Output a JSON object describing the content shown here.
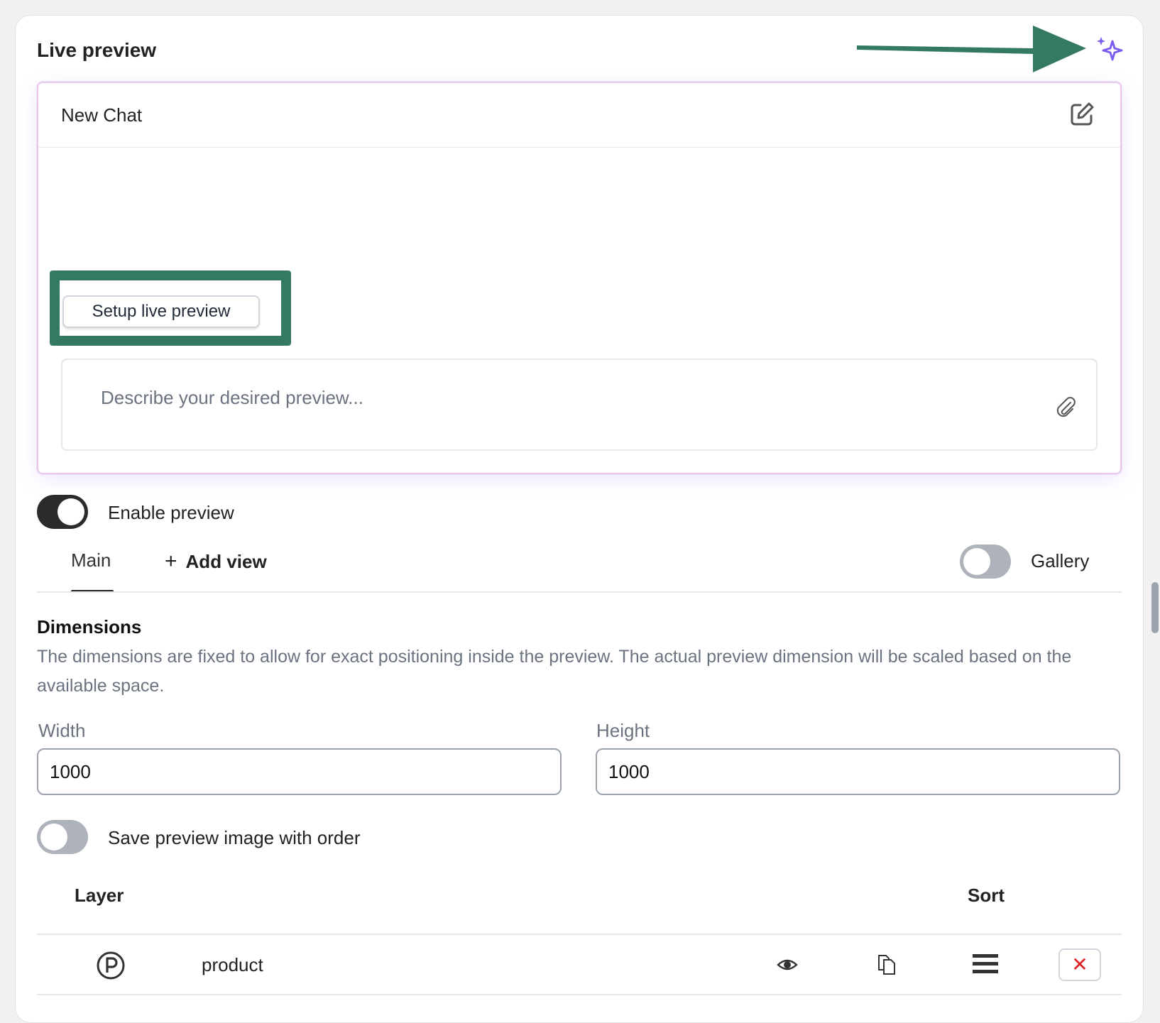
{
  "section": {
    "title": "Live preview"
  },
  "chat": {
    "title": "New Chat",
    "setup_button_label": "Setup live preview",
    "prompt_placeholder": "Describe your desired preview..."
  },
  "enable_preview": {
    "label": "Enable preview",
    "enabled": true
  },
  "tabs": {
    "main_label": "Main",
    "add_view_plus": "+",
    "add_view_label": "Add view",
    "gallery_label": "Gallery",
    "gallery_enabled": false
  },
  "dimensions": {
    "title": "Dimensions",
    "description": "The dimensions are fixed to allow for exact positioning inside the preview. The actual preview dimension will be scaled based on the available space.",
    "width_label": "Width",
    "width_value": "1000",
    "height_label": "Height",
    "height_value": "1000"
  },
  "save_image": {
    "label": "Save preview image with order",
    "enabled": false
  },
  "layers": {
    "col_layer": "Layer",
    "col_sort": "Sort",
    "rows": [
      {
        "name": "product",
        "delete_symbol": "✕"
      }
    ]
  },
  "colors": {
    "annotation_green": "#347a62",
    "sparkle_purple": "#7c5cf0",
    "toggle_on": "#2b2b2b",
    "toggle_off": "#aeb3bb",
    "delete_red": "#dc2626"
  },
  "icons": [
    "sparkle-icon",
    "edit-icon",
    "paperclip-icon",
    "product-icon",
    "eye-icon",
    "copy-icon",
    "drag-handle-icon",
    "close-icon"
  ]
}
